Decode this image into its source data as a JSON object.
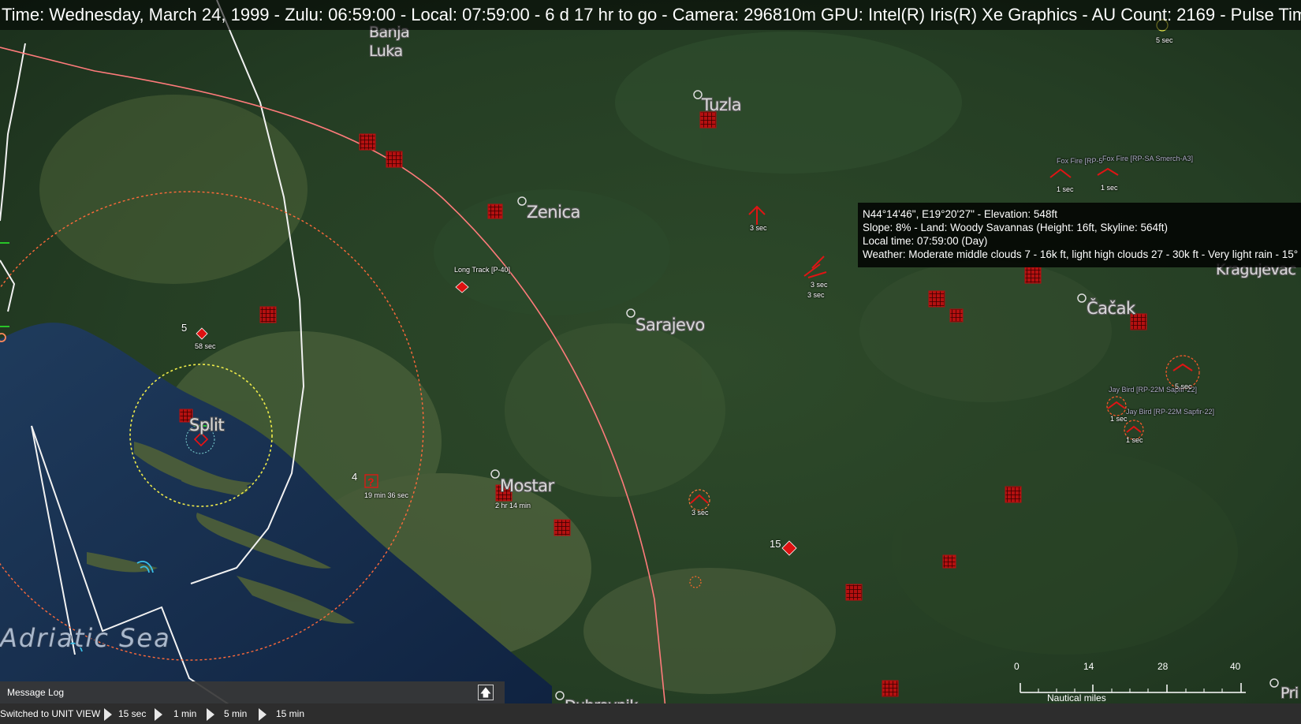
{
  "topbar": {
    "text": "Time: Wednesday, March 24, 1999 - Zulu: 06:59:00 - Local: 07:59:00 - 6 d 17 hr to go -  Camera: 296810m  GPU: Intel(R) Iris(R) Xe Graphics - AU Count: 2169 - Pulse Tim"
  },
  "cities": {
    "banja": "Banja",
    "luka": "Luka",
    "tuzla": "Tuzla",
    "zenica": "Zenica",
    "sarajevo": "Sarajevo",
    "mostar": "Mostar",
    "split": "Split",
    "cacak": "Čačak",
    "kragujevac": "Kragujevac",
    "dubrovnik": "Dubrovnik",
    "pri": "Pri"
  },
  "sea": {
    "label": "Adriatic Sea"
  },
  "tooltip": {
    "coords": "N44°14'46\", E19°20'27\" - Elevation: 548ft",
    "slope": "Slope: 8%  - Land: Woody Savannas (Height: 16ft, Skyline: 564ft)",
    "localtime": "Local time: 07:59:00 (Day)",
    "weather": "Weather: Moderate middle clouds 7 - 16k ft, light high clouds 27 - 30k ft - Very light rain - 15°"
  },
  "units": {
    "long_track": "Long Track [P-40]",
    "fox_fire_1": "Fox Fire [RP-5",
    "fox_fire_2": "Fox Fire [RP-SA Smerch-A3]",
    "jay_bird_1": "Jay Bird [RP-22M Sapfir-22]",
    "jay_bird_2": "Jay Bird [RP-22M Sapfir-22]",
    "t_58sec": "58 sec",
    "t_19min": "19 min 36 sec",
    "t_2hr": "2 hr 14 min",
    "t_3sec_a": "3 sec",
    "t_3sec_b": "3 sec",
    "t_3sec_c": "3 sec",
    "t_3sec_d": "3 sec",
    "t_1sec_a": "1 sec",
    "t_1sec_b": "1 sec",
    "t_1sec_c": "1 sec",
    "t_1sec_d": "1 sec",
    "t_5sec_a": "5 sec",
    "t_5sec_b": "5 sec",
    "n5": "5",
    "n4": "4",
    "n15": "15"
  },
  "scale": {
    "ticks": [
      "0",
      "14",
      "28",
      "40"
    ],
    "caption": "Nautical miles"
  },
  "message_log": {
    "label": "Message Log",
    "button_icon": "expand-icon"
  },
  "statusbar": {
    "status": "Switched to UNIT VIEW",
    "steps": [
      "15 sec",
      "1 min",
      "5 min",
      "15 min"
    ]
  },
  "colors": {
    "hostile": "#cc1111",
    "range_ring": "#ff6a6a",
    "border": "#ffffff",
    "yellow_ring": "#e8e84a"
  }
}
